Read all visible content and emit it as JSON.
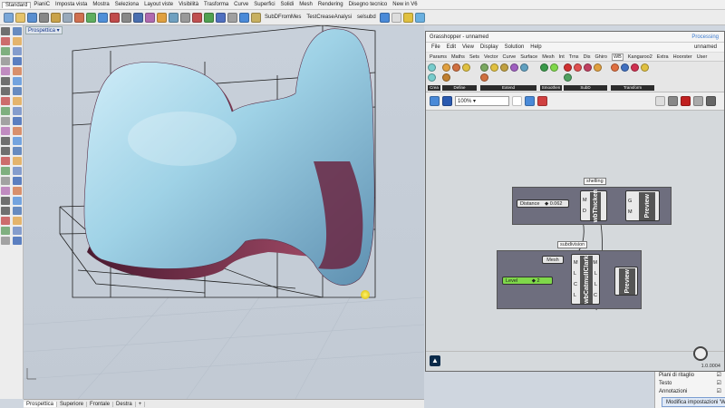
{
  "rhino": {
    "toolbar_tabs": [
      "Standard",
      "PianiC",
      "Imposta vista",
      "Mostra",
      "Seleziona",
      "Layout viste",
      "Visibilità",
      "Trasforma",
      "Curve",
      "Superfici",
      "Solidi",
      "Mesh",
      "Rendering",
      "Disegno tecnico",
      "New in V6"
    ],
    "toolbar_commands": [
      "SubDFromMes",
      "TestCreaseAnalysi",
      "selsubd"
    ],
    "viewport": {
      "label": "Prospettica"
    },
    "bottom_tabs": [
      "Prospettica",
      "Superiore",
      "Frontale",
      "Destra"
    ],
    "properties": [
      {
        "label": "Piani di ritaglio",
        "value": ""
      },
      {
        "label": "Testo",
        "value": ""
      },
      {
        "label": "Annotazioni",
        "value": ""
      }
    ],
    "tooltip": "Modifica impostazioni 'Weste"
  },
  "grasshopper": {
    "title": "Grasshopper - unnamed",
    "title_right": "Processing",
    "menu": [
      "File",
      "Edit",
      "View",
      "Display",
      "Solution",
      "Help"
    ],
    "doc_name": "unnamed",
    "tabs": [
      "Params",
      "Maths",
      "Sets",
      "Vector",
      "Curve",
      "Surface",
      "Mesh",
      "Int",
      "Trns",
      "Dis",
      "Ghiro",
      "WB",
      "Kangaroo2",
      "Extra",
      "Hoorster",
      "User"
    ],
    "active_tab": "WB",
    "component_groups": [
      "Crea",
      "Define",
      "Extend",
      "Smoothen",
      "SubD",
      "Transform"
    ],
    "zoom": "100%",
    "groups": [
      {
        "label": "shelling",
        "slider_name": "Distance",
        "slider_value": "0.062",
        "component": "wbThicken",
        "preview": "Preview",
        "inputs": [
          "M",
          "D"
        ],
        "outputs": [
          "G",
          "M"
        ]
      },
      {
        "label": "subdivision",
        "mesh_param": "Mesh",
        "slider_name": "Level",
        "slider_value": "2",
        "component": "wbCatmullClark",
        "preview": "Preview",
        "inputs": [
          "M",
          "L",
          "C",
          "L"
        ],
        "outputs": [
          "M",
          "L",
          "L",
          "C"
        ]
      }
    ],
    "version": "1.0.0004"
  },
  "colors": {
    "group_bg": "#6e6e7e",
    "slider_green": "#7fd84a",
    "surface": "#a9d8e8",
    "surface_inner": "#7a2d4a"
  }
}
